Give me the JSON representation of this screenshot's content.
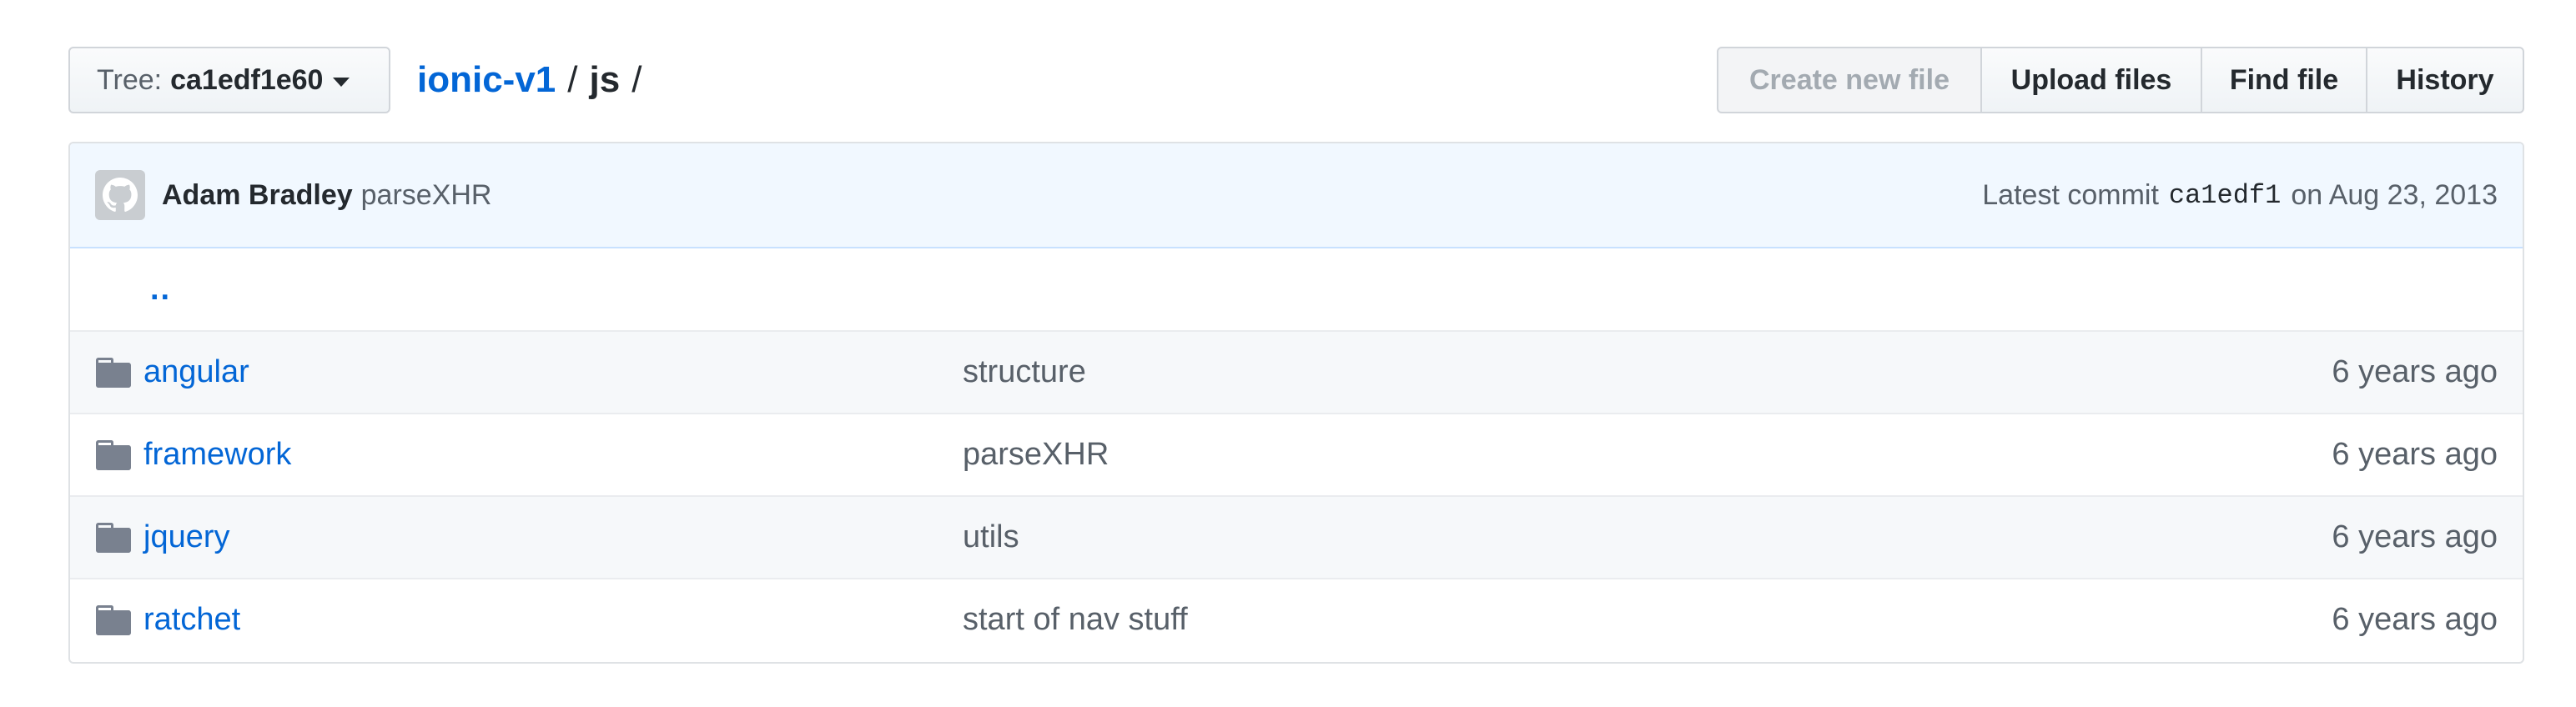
{
  "tree": {
    "label": "Tree:",
    "value": "ca1edf1e60"
  },
  "breadcrumb": {
    "repo": "ionic-v1",
    "separator": "/",
    "current": "js",
    "trailing": "/"
  },
  "actions": {
    "create_new_file": "Create new file",
    "upload_files": "Upload files",
    "find_file": "Find file",
    "history": "History"
  },
  "commit": {
    "author": "Adam Bradley",
    "message": "parseXHR",
    "latest_label": "Latest commit",
    "sha": "ca1edf1",
    "date_text": "on Aug 23, 2013"
  },
  "parent_link": "..",
  "files": [
    {
      "name": "angular",
      "message": "structure",
      "age": "6 years ago",
      "type": "folder-icon"
    },
    {
      "name": "framework",
      "message": "parseXHR",
      "age": "6 years ago",
      "type": "folder-icon"
    },
    {
      "name": "jquery",
      "message": "utils",
      "age": "6 years ago",
      "type": "folder-icon"
    },
    {
      "name": "ratchet",
      "message": "start of nav stuff",
      "age": "6 years ago",
      "type": "folder-icon"
    }
  ],
  "colors": {
    "link": "#0366d6",
    "muted": "#586069",
    "commit_bg": "#f1f8ff",
    "folder": "#79818f"
  }
}
